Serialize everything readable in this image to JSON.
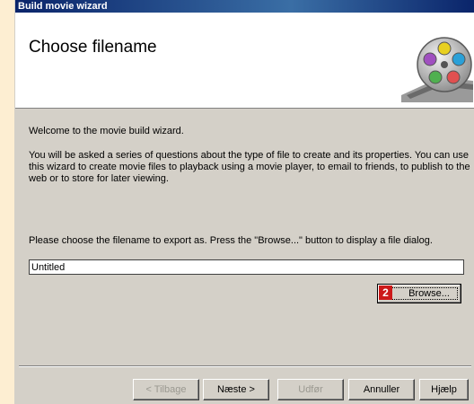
{
  "window": {
    "title": "Build movie wizard"
  },
  "header": {
    "title": "Choose filename",
    "logo_icon": "film-reel-icon"
  },
  "body": {
    "welcome": "Welcome to the movie build wizard.",
    "description": "You will be asked a series of questions about the type of file to create and its properties. You can use this wizard to create movie files to playback using a movie player, to email to friends, to publish to the web or to store for later viewing.",
    "prompt": "Please choose the filename to export as. Press the \"Browse...\" button to display a file dialog."
  },
  "filename": {
    "value": "Untitled"
  },
  "browse": {
    "label": "Browse...",
    "step_badge": "2",
    "badge_color": "#cc1a1a"
  },
  "footer": {
    "back_label": "< Tilbage",
    "next_label": "Næste >",
    "finish_label": "Udfør",
    "cancel_label": "Annuller",
    "help_label": "Hjælp"
  }
}
